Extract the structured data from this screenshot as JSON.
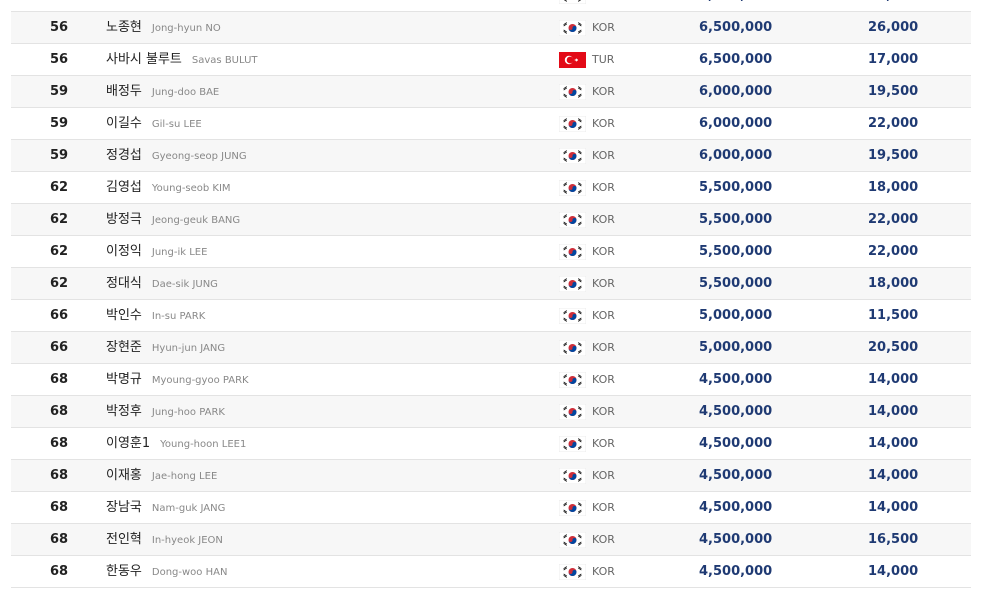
{
  "rows": [
    {
      "rank": "56",
      "name_ko": "",
      "name_en": "",
      "country": "KOR",
      "prize": "6,500,000",
      "points": "26,000"
    },
    {
      "rank": "56",
      "name_ko": "노종현",
      "name_en": "Jong-hyun NO",
      "country": "KOR",
      "prize": "6,500,000",
      "points": "26,000"
    },
    {
      "rank": "56",
      "name_ko": "사바시 불루트",
      "name_en": "Savas BULUT",
      "country": "TUR",
      "prize": "6,500,000",
      "points": "17,000"
    },
    {
      "rank": "59",
      "name_ko": "배정두",
      "name_en": "Jung-doo BAE",
      "country": "KOR",
      "prize": "6,000,000",
      "points": "19,500"
    },
    {
      "rank": "59",
      "name_ko": "이길수",
      "name_en": "Gil-su LEE",
      "country": "KOR",
      "prize": "6,000,000",
      "points": "22,000"
    },
    {
      "rank": "59",
      "name_ko": "정경섭",
      "name_en": "Gyeong-seop JUNG",
      "country": "KOR",
      "prize": "6,000,000",
      "points": "19,500"
    },
    {
      "rank": "62",
      "name_ko": "김영섭",
      "name_en": "Young-seob KIM",
      "country": "KOR",
      "prize": "5,500,000",
      "points": "18,000"
    },
    {
      "rank": "62",
      "name_ko": "방정극",
      "name_en": "Jeong-geuk BANG",
      "country": "KOR",
      "prize": "5,500,000",
      "points": "22,000"
    },
    {
      "rank": "62",
      "name_ko": "이정익",
      "name_en": "Jung-ik LEE",
      "country": "KOR",
      "prize": "5,500,000",
      "points": "22,000"
    },
    {
      "rank": "62",
      "name_ko": "정대식",
      "name_en": "Dae-sik JUNG",
      "country": "KOR",
      "prize": "5,500,000",
      "points": "18,000"
    },
    {
      "rank": "66",
      "name_ko": "박인수",
      "name_en": "In-su PARK",
      "country": "KOR",
      "prize": "5,000,000",
      "points": "11,500"
    },
    {
      "rank": "66",
      "name_ko": "장현준",
      "name_en": "Hyun-jun JANG",
      "country": "KOR",
      "prize": "5,000,000",
      "points": "20,500"
    },
    {
      "rank": "68",
      "name_ko": "박명규",
      "name_en": "Myoung-gyoo PARK",
      "country": "KOR",
      "prize": "4,500,000",
      "points": "14,000"
    },
    {
      "rank": "68",
      "name_ko": "박정후",
      "name_en": "Jung-hoo PARK",
      "country": "KOR",
      "prize": "4,500,000",
      "points": "14,000"
    },
    {
      "rank": "68",
      "name_ko": "이영훈1",
      "name_en": "Young-hoon LEE1",
      "country": "KOR",
      "prize": "4,500,000",
      "points": "14,000"
    },
    {
      "rank": "68",
      "name_ko": "이재홍",
      "name_en": "Jae-hong LEE",
      "country": "KOR",
      "prize": "4,500,000",
      "points": "14,000"
    },
    {
      "rank": "68",
      "name_ko": "장남국",
      "name_en": "Nam-guk JANG",
      "country": "KOR",
      "prize": "4,500,000",
      "points": "14,000"
    },
    {
      "rank": "68",
      "name_ko": "전인혁",
      "name_en": "In-hyeok JEON",
      "country": "KOR",
      "prize": "4,500,000",
      "points": "16,500"
    },
    {
      "rank": "68",
      "name_ko": "한동우",
      "name_en": "Dong-woo HAN",
      "country": "KOR",
      "prize": "4,500,000",
      "points": "14,000"
    }
  ],
  "flags": {
    "KOR": "korea-flag-icon",
    "TUR": "turkey-flag-icon"
  },
  "colors": {
    "value_text": "#1f3a73",
    "row_alt": "#f7f7f7",
    "row_border": "#e3e3e3",
    "turkey_red": "#e30a17"
  }
}
